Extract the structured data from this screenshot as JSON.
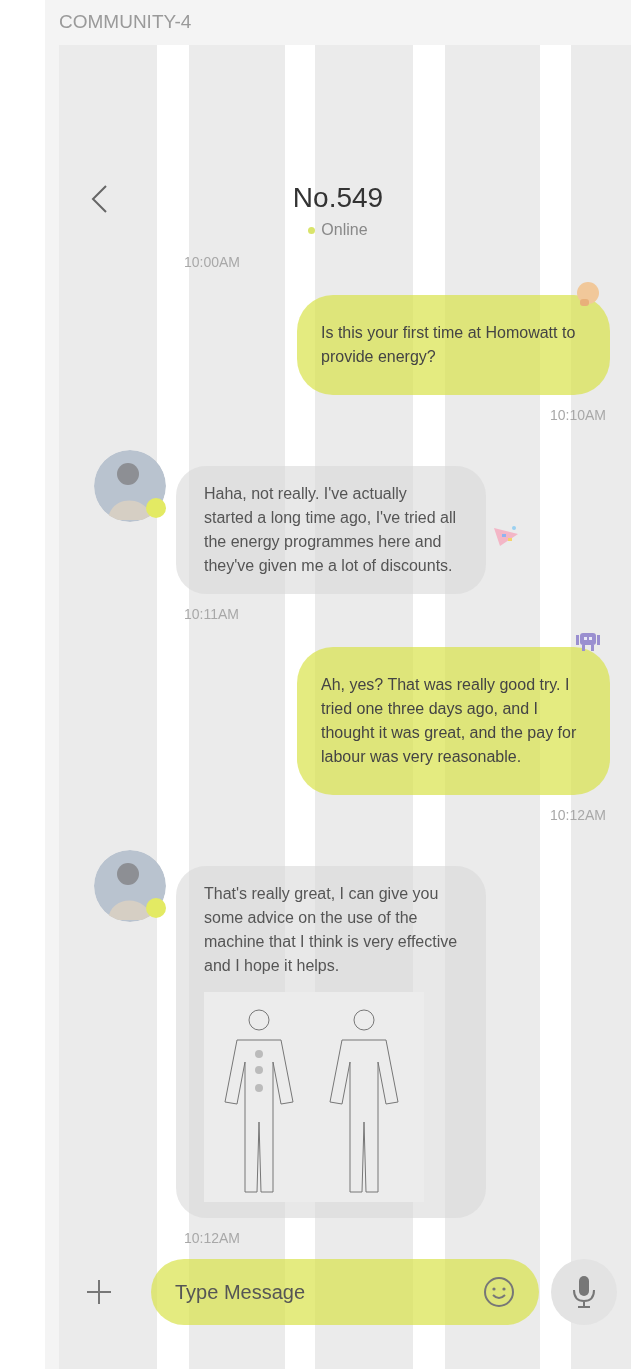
{
  "frame": {
    "title": "COMMUNITY-4"
  },
  "header": {
    "title": "No.549",
    "status": "Online"
  },
  "items": [
    {
      "kind": "timeleft",
      "text": "10:00AM"
    },
    {
      "kind": "sent",
      "text": "Is this your first time at Homowatt to provide energy?",
      "reaction": {
        "kind": "thinking"
      }
    },
    {
      "kind": "timeright",
      "text": "10:10AM"
    },
    {
      "kind": "received",
      "text": "Haha, not really. I've actually started a long time ago, I've tried all the energy programmes here and they've given me a lot of discounts.",
      "reaction": {
        "kind": "party"
      }
    },
    {
      "kind": "timeleft",
      "text": "10:11AM"
    },
    {
      "kind": "sent",
      "text": "Ah, yes? That was really good try. I tried one three days ago, and I thought it was great, and the pay for labour was very reasonable.",
      "reaction": {
        "kind": "invader"
      }
    },
    {
      "kind": "timeright",
      "text": "10:12AM"
    },
    {
      "kind": "received",
      "text": "That's really great, I can give you some advice on the use of the machine that I think is very effective and I hope it helps."
    },
    {
      "kind": "timeleft",
      "text": "10:12AM"
    }
  ],
  "composer": {
    "placeholder": "Type Message"
  }
}
